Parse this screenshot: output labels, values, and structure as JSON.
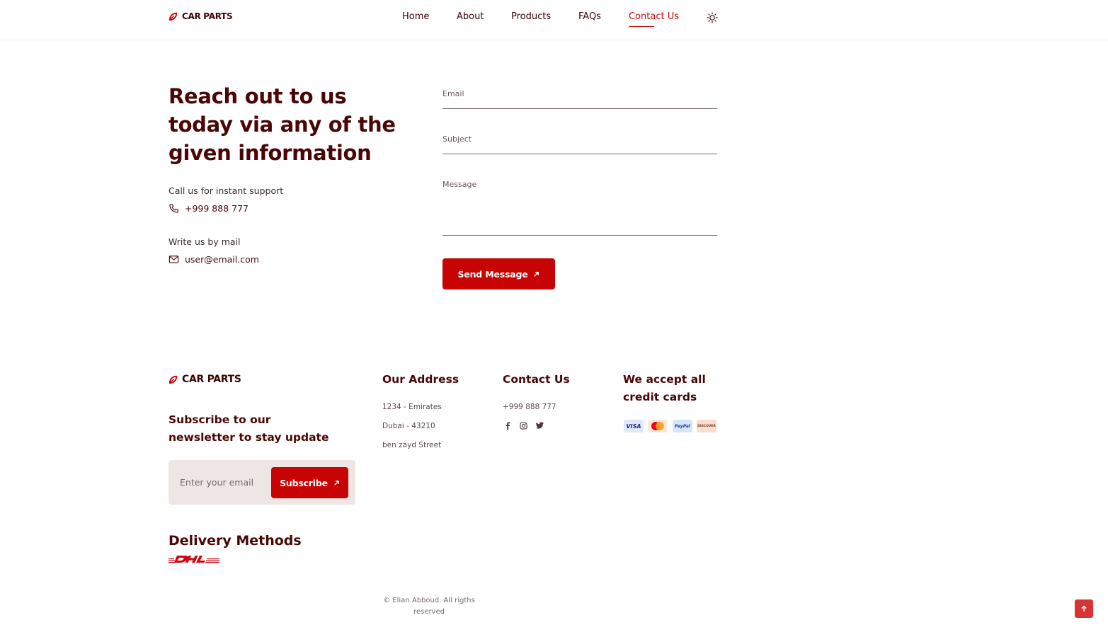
{
  "header": {
    "brand": "CAR PARTS",
    "nav": [
      {
        "label": "Home",
        "active": false
      },
      {
        "label": "About",
        "active": false
      },
      {
        "label": "Products",
        "active": false
      },
      {
        "label": "FAQs",
        "active": false
      },
      {
        "label": "Contact Us",
        "active": true
      }
    ],
    "theme_icon": "sun-icon"
  },
  "contact": {
    "title": "Reach out to us today via any of the given information",
    "call_label": "Call us for instant support",
    "phone": "+999 888 777",
    "mail_label": "Write us by mail",
    "email": "user@email.com",
    "form": {
      "email_placeholder": "Email",
      "subject_placeholder": "Subject",
      "message_placeholder": "Message",
      "send_label": "Send Message"
    }
  },
  "footer": {
    "brand": "CAR PARTS",
    "newsletter_heading": "Subscribe to our newsletter to stay update",
    "newsletter_placeholder": "Enter your email",
    "subscribe_label": "Subscribe",
    "address_heading": "Our Address",
    "address_lines": [
      "1234 - Emirates",
      "Dubai - 43210",
      "ben zayd Street"
    ],
    "contact_heading": "Contact Us",
    "contact_phone": "+999 888 777",
    "social_icons": [
      "facebook-icon",
      "instagram-icon",
      "twitter-icon"
    ],
    "cards_heading": "We accept all credit cards",
    "cards": [
      "VISA",
      "Mastercard",
      "PayPal",
      "DISCOVER"
    ],
    "delivery_heading": "Delivery Methods",
    "delivery_logo": "DHL",
    "copyright": "© Elian Abboud. All rigths reserved"
  },
  "colors": {
    "accent": "#c80303",
    "heading": "#4a0505",
    "newsletter_bg": "#ede6e4"
  }
}
